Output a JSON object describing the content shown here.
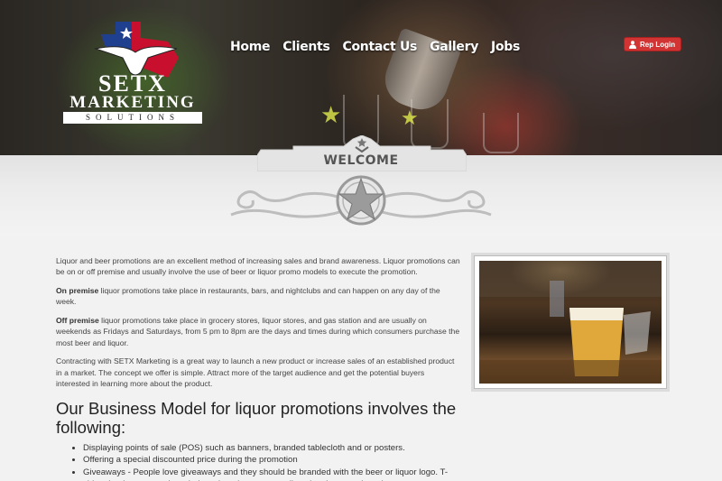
{
  "logo": {
    "line1": "SETX",
    "line2": "MARKETING",
    "line3": "SOLUTIONS"
  },
  "nav": {
    "items": [
      "Home",
      "Clients",
      "Contact Us",
      "Gallery",
      "Jobs"
    ]
  },
  "rep_login": {
    "label": "Rep Login"
  },
  "banner": {
    "title": "WELCOME"
  },
  "content": {
    "p1": "Liquor and beer promotions are an excellent method of increasing sales and brand awareness. Liquor promotions can be on or off premise and usually involve the use of beer or liquor promo models to execute the promotion.",
    "p2_bold": "On premise",
    "p2_text": " liquor promotions take place in restaurants, bars, and nightclubs and can happen on any day of the week.",
    "p3_bold": "Off premise",
    "p3_text": " liquor promotions take place in grocery stores, liquor stores, and gas station and are usually on weekends as Fridays and Saturdays, from 5 pm to 8pm are the days and times during which consumers purchase the most beer and liquor.",
    "p4": "Contracting with SETX Marketing is a great way to launch a new product or increase sales of an established product in a market. The concept we offer is simple. Attract more of the target audience and get the potential buyers interested in learning more about the product.",
    "heading": "Our Business Model for liquor promotions involves the following:",
    "bullets": [
      "Displaying points of sale (POS) such as banners, branded tablecloth and or posters.",
      "Offering a special discounted price during the promotion",
      "Giveaways - People love giveaways and they should be branded with the beer or liquor logo. T-shirts, bottle openers, key chains, shot glasses, as well as they increase brand awareness."
    ]
  },
  "colors": {
    "accent_red": "#d23434",
    "texas_blue": "#1f3f8f",
    "texas_red": "#c8102e"
  }
}
